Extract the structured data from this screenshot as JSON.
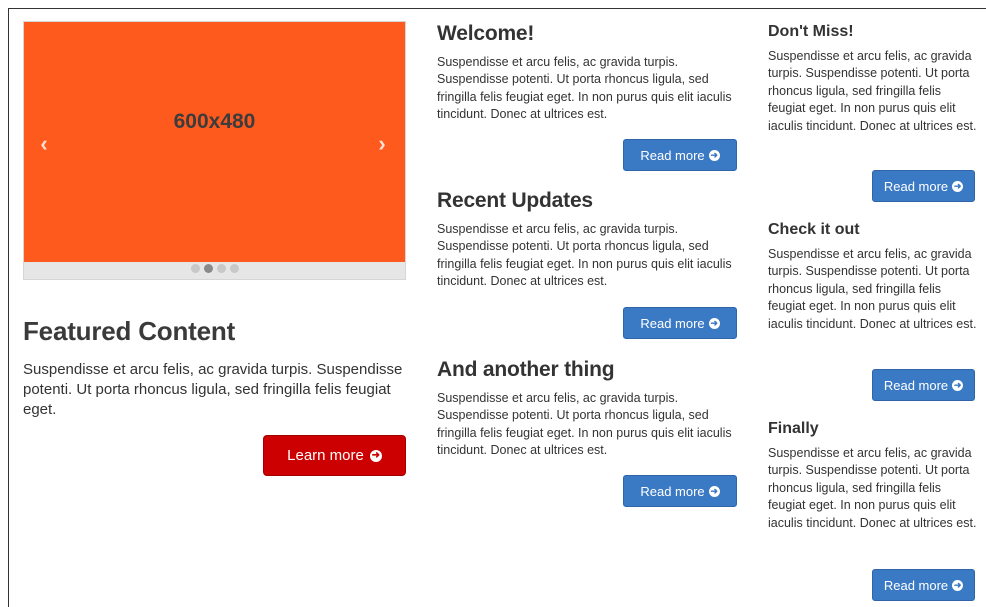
{
  "carousel": {
    "slide_label": "600x480",
    "prev_icon": "‹",
    "next_icon": "›",
    "dot_count": 4,
    "active_dot": 1,
    "slide_color": "#ff5a1d"
  },
  "featured": {
    "title": "Featured Content",
    "text": "Suspendisse et arcu felis, ac gravida turpis. Suspendisse potenti. Ut porta rhoncus ligula, sed fringilla felis feugiat eget.",
    "button_label": "Learn more",
    "button_color": "#cc0000"
  },
  "middle": [
    {
      "title": "Welcome!",
      "text": "Suspendisse et arcu felis, ac gravida turpis. Suspendisse potenti. Ut porta rhoncus ligula, sed fringilla felis feugiat eget. In non purus quis elit iaculis tincidunt. Donec at ultrices est.",
      "button_label": "Read more"
    },
    {
      "title": "Recent Updates",
      "text": "Suspendisse et arcu felis, ac gravida turpis. Suspendisse potenti. Ut porta rhoncus ligula, sed fringilla felis feugiat eget. In non purus quis elit iaculis tincidunt. Donec at ultrices est.",
      "button_label": "Read more"
    },
    {
      "title": "And another thing",
      "text": "Suspendisse et arcu felis, ac gravida turpis. Suspendisse potenti. Ut porta rhoncus ligula, sed fringilla felis feugiat eget. In non purus quis elit iaculis tincidunt. Donec at ultrices est.",
      "button_label": "Read more"
    }
  ],
  "right": [
    {
      "title": "Don't Miss!",
      "text": "Suspendisse et arcu felis, ac gravida turpis. Suspendisse potenti. Ut porta rhoncus ligula, sed fringilla felis feugiat eget. In non purus quis elit iaculis tincidunt. Donec at ultrices est.",
      "button_label": "Read more"
    },
    {
      "title": "Check it out",
      "text": "Suspendisse et arcu felis, ac gravida turpis. Suspendisse potenti. Ut porta rhoncus ligula, sed fringilla felis feugiat eget. In non purus quis elit iaculis tincidunt. Donec at ultrices est.",
      "button_label": "Read more"
    },
    {
      "title": "Finally",
      "text": "Suspendisse et arcu felis, ac gravida turpis. Suspendisse potenti. Ut porta rhoncus ligula, sed fringilla felis feugiat eget. In non purus quis elit iaculis tincidunt. Donec at ultrices est.",
      "button_label": "Read more"
    }
  ],
  "colors": {
    "accent_blue": "#3a79c3"
  }
}
